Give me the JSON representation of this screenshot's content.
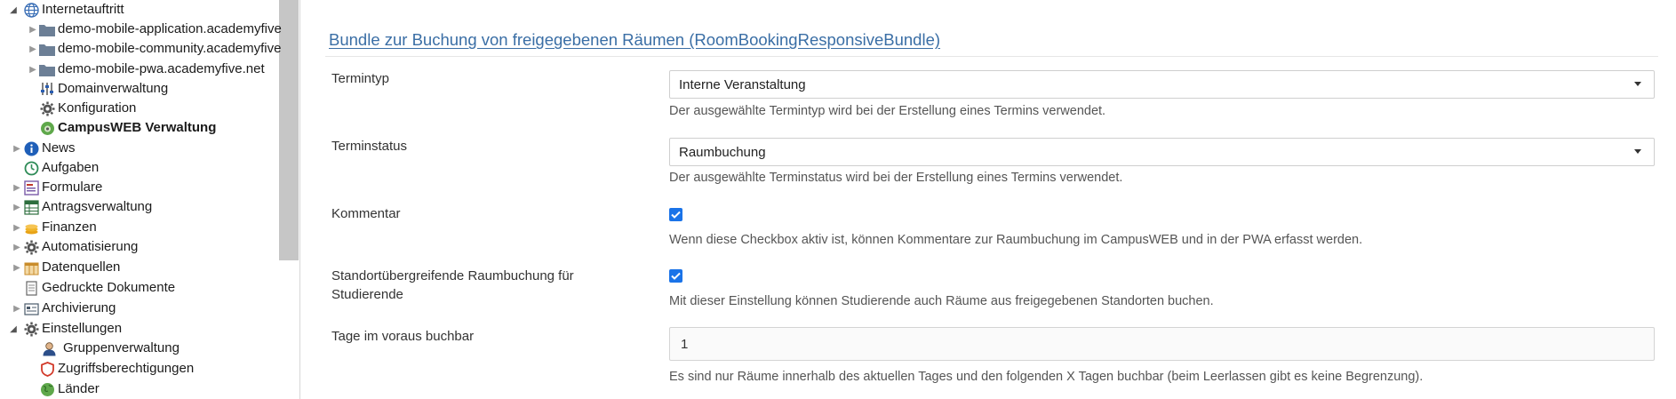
{
  "sidebar": {
    "items": [
      {
        "label": "Internetauftritt",
        "icon": "globe-icon",
        "expanded": true
      },
      {
        "label": "demo-mobile-application.academyfive",
        "icon": "folder-icon"
      },
      {
        "label": "demo-mobile-community.academyfive",
        "icon": "folder-icon"
      },
      {
        "label": "demo-mobile-pwa.academyfive.net",
        "icon": "folder-icon"
      },
      {
        "label": "Domainverwaltung",
        "icon": "sliders-icon"
      },
      {
        "label": "Konfiguration",
        "icon": "gear-icon"
      },
      {
        "label": "CampusWEB Verwaltung",
        "icon": "campusweb-icon",
        "selected": true
      },
      {
        "label": "News",
        "icon": "info-icon"
      },
      {
        "label": "Aufgaben",
        "icon": "clock-icon"
      },
      {
        "label": "Formulare",
        "icon": "form-icon"
      },
      {
        "label": "Antragsverwaltung",
        "icon": "table-icon"
      },
      {
        "label": "Finanzen",
        "icon": "coins-icon"
      },
      {
        "label": "Automatisierung",
        "icon": "gear-icon"
      },
      {
        "label": "Datenquellen",
        "icon": "database-icon"
      },
      {
        "label": "Gedruckte Dokumente",
        "icon": "document-icon"
      },
      {
        "label": "Archivierung",
        "icon": "archive-icon"
      },
      {
        "label": "Einstellungen",
        "icon": "gear-icon",
        "expanded": true
      },
      {
        "label": "Gruppenverwaltung",
        "icon": "user-icon"
      },
      {
        "label": "Zugriffsberechtigungen",
        "icon": "shield-icon"
      },
      {
        "label": "Länder",
        "icon": "globe-green-icon"
      }
    ]
  },
  "main": {
    "title": "Bundle zur Buchung von freigegebenen Räumen (RoomBookingResponsiveBundle)",
    "fields": {
      "termintyp": {
        "label": "Termintyp",
        "value": "Interne Veranstaltung",
        "help": "Der ausgewählte Termintyp wird bei der Erstellung eines Termins verwendet."
      },
      "terminstatus": {
        "label": "Terminstatus",
        "value": "Raumbuchung",
        "help": "Der ausgewählte Terminstatus wird bei der Erstellung eines Termins verwendet."
      },
      "kommentar": {
        "label": "Kommentar",
        "checked": true,
        "help": "Wenn diese Checkbox aktiv ist, können Kommentare zur Raumbuchung im CampusWEB und in der PWA erfasst werden."
      },
      "standort": {
        "label_line1": "Standortübergreifende Raumbuchung für",
        "label_line2": "Studierende",
        "checked": true,
        "help": "Mit dieser Einstellung können Studierende auch Räume aus freigegebenen Standorten buchen."
      },
      "tage": {
        "label": "Tage im voraus buchbar",
        "value": "1",
        "help": "Es sind nur Räume innerhalb des aktuellen Tages und den folgenden X Tagen buchbar (beim Leerlassen gibt es keine Begrenzung)."
      }
    }
  },
  "colors": {
    "link": "#3a6ea5",
    "checkbox": "#1a73e8",
    "scrollbar": "#c6c6c6"
  }
}
